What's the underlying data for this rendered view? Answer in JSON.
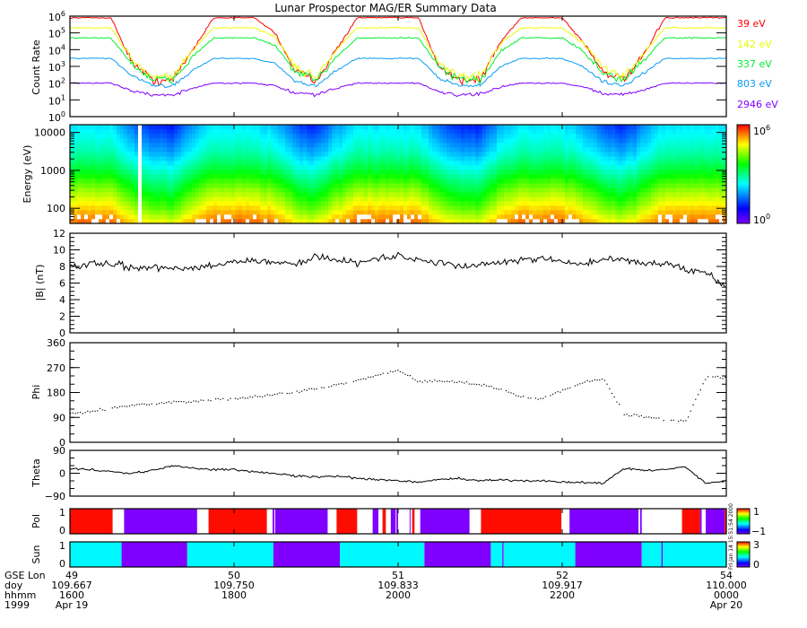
{
  "title": "Lunar Prospector MAG/ER Summary Data",
  "footer_timestamp": "Fri Jan 14 15:51:54 2000",
  "time_axis": {
    "row_labels": [
      "GSE Lon",
      "doy",
      "hhmm",
      "1999"
    ],
    "range_hours": [
      16,
      24
    ],
    "ticks": [
      {
        "hour": 16,
        "lon": "49",
        "doy": "109.667",
        "hhmm": "1600",
        "date": "Apr 19"
      },
      {
        "hour": 18,
        "lon": "50",
        "doy": "109.750",
        "hhmm": "1800",
        "date": ""
      },
      {
        "hour": 20,
        "lon": "51",
        "doy": "109.833",
        "hhmm": "2000",
        "date": ""
      },
      {
        "hour": 22,
        "lon": "52",
        "doy": "109.917",
        "hhmm": "2200",
        "date": ""
      },
      {
        "hour": 24,
        "lon": "54",
        "doy": "110.000",
        "hhmm": "0000",
        "date": "Apr 20"
      }
    ]
  },
  "chart_data": [
    {
      "type": "line",
      "ylabel": "Count Rate",
      "yscale": "log",
      "ylim": [
        1,
        1000000
      ],
      "yticks": [
        {
          "base": "10",
          "exp": "0"
        },
        {
          "base": "10",
          "exp": "1"
        },
        {
          "base": "10",
          "exp": "2"
        },
        {
          "base": "10",
          "exp": "3"
        },
        {
          "base": "10",
          "exp": "4"
        },
        {
          "base": "10",
          "exp": "5"
        },
        {
          "base": "10",
          "exp": "6"
        }
      ],
      "legend": "right",
      "x_hours": [
        16,
        16.25,
        16.5,
        16.75,
        17,
        17.25,
        17.5,
        17.75,
        18,
        18.25,
        18.5,
        18.75,
        19,
        19.25,
        19.5,
        19.75,
        20,
        20.25,
        20.5,
        20.75,
        21,
        21.25,
        21.5,
        21.75,
        22,
        22.25,
        22.5,
        22.75,
        23,
        23.25,
        23.5,
        23.75,
        24
      ],
      "series": [
        {
          "name": "39 eV",
          "color": "#ff0000",
          "values": [
            800000.0,
            800000.0,
            800000.0,
            2000.0,
            150,
            150,
            10000.0,
            800000.0,
            800000.0,
            800000.0,
            100000.0,
            500,
            150,
            10000.0,
            800000.0,
            800000.0,
            800000.0,
            800000.0,
            1000.0,
            150,
            150,
            30000.0,
            800000.0,
            800000.0,
            800000.0,
            30000.0,
            500,
            150,
            5000.0,
            800000.0,
            800000.0,
            800000.0,
            800000.0
          ]
        },
        {
          "name": "142 eV",
          "color": "#e8ff00",
          "values": [
            200000.0,
            200000.0,
            200000.0,
            3000.0,
            250,
            250,
            10000.0,
            200000.0,
            200000.0,
            200000.0,
            60000.0,
            800,
            250,
            10000.0,
            200000.0,
            200000.0,
            200000.0,
            200000.0,
            1500,
            250,
            250,
            25000.0,
            200000.0,
            200000.0,
            200000.0,
            25000.0,
            800,
            250,
            6000.0,
            200000.0,
            200000.0,
            200000.0,
            200000.0
          ]
        },
        {
          "name": "337 eV",
          "color": "#00f030",
          "values": [
            50000.0,
            50000.0,
            50000.0,
            1500,
            150,
            150,
            4000.0,
            50000.0,
            50000.0,
            50000.0,
            18000.0,
            400,
            150,
            4000.0,
            50000.0,
            50000.0,
            50000.0,
            50000.0,
            800,
            150,
            150,
            8000.0,
            50000.0,
            50000.0,
            50000.0,
            8000.0,
            400,
            150,
            2500,
            50000.0,
            50000.0,
            50000.0,
            50000.0
          ]
        },
        {
          "name": "803 eV",
          "color": "#0a9cf5",
          "values": [
            3000.0,
            3000.0,
            3000.0,
            300,
            70,
            70,
            600,
            3000.0,
            3000.0,
            3000.0,
            1500,
            120,
            70,
            600,
            3000.0,
            3000.0,
            3000.0,
            3000.0,
            200,
            70,
            70,
            1000.0,
            3000.0,
            3000.0,
            3000.0,
            1000.0,
            120,
            70,
            400,
            3000.0,
            3000.0,
            3000.0,
            3000.0
          ]
        },
        {
          "name": "2946 eV",
          "color": "#8000ff",
          "values": [
            100,
            100,
            100,
            35,
            20,
            20,
            50,
            100,
            100,
            100,
            70,
            25,
            20,
            50,
            100,
            100,
            100,
            100,
            30,
            20,
            20,
            60,
            100,
            100,
            100,
            60,
            25,
            20,
            40,
            100,
            100,
            100,
            100
          ]
        }
      ]
    },
    {
      "type": "heatmap",
      "ylabel": "Energy (eV)",
      "yscale": "log",
      "ylim": [
        40,
        16000
      ],
      "yticks": [
        "100",
        "1000",
        "10000"
      ],
      "colorbar": {
        "min": 1,
        "max": 1000000,
        "min_label": {
          "base": "10",
          "exp": "0"
        },
        "max_label": {
          "base": "10",
          "exp": "6"
        }
      },
      "energies": [
        50,
        100,
        300,
        1000,
        3000,
        10000
      ],
      "rows": [
        [
          250000.0,
          250000.0,
          250000.0,
          80000.0,
          40000.0,
          40000.0,
          130000.0,
          250000.0,
          250000.0,
          250000.0,
          180000.0,
          50000.0,
          40000.0,
          130000.0,
          250000.0,
          250000.0,
          250000.0,
          250000.0,
          65000.0,
          40000.0,
          40000.0,
          150000.0,
          250000.0,
          250000.0,
          250000.0,
          150000.0,
          50000.0,
          40000.0,
          100000.0,
          250000.0,
          250000.0,
          250000.0,
          250000.0
        ],
        [
          100000.0,
          100000.0,
          100000.0,
          25000.0,
          10000.0,
          10000.0,
          40000.0,
          100000.0,
          100000.0,
          100000.0,
          63000.0,
          16000.0,
          10000.0,
          40000.0,
          100000.0,
          100000.0,
          100000.0,
          100000.0,
          20000.0,
          10000.0,
          10000.0,
          50000.0,
          100000.0,
          100000.0,
          100000.0,
          50000.0,
          16000.0,
          10000.0,
          32000.0,
          100000.0,
          100000.0,
          100000.0,
          100000.0
        ],
        [
          20000.0,
          20000.0,
          20000.0,
          5000.0,
          2000.0,
          2000.0,
          8000.0,
          20000.0,
          20000.0,
          20000.0,
          12600.0,
          3200.0,
          2000.0,
          8000.0,
          20000.0,
          20000.0,
          20000.0,
          20000.0,
          4000.0,
          2000.0,
          2000.0,
          10000.0,
          20000.0,
          20000.0,
          20000.0,
          10000.0,
          3200.0,
          2000.0,
          6300.0,
          20000.0,
          20000.0,
          20000.0,
          20000.0
        ],
        [
          2500,
          2500,
          2500,
          800,
          400,
          400,
          1300,
          2500,
          2500,
          2500,
          1800,
          500,
          400,
          1300,
          2500,
          2500,
          2500,
          2500,
          650,
          400,
          400,
          1500,
          2500,
          2500,
          2500,
          1500,
          500,
          400,
          1000,
          2500,
          2500,
          2500,
          2500
        ],
        [
          630,
          630,
          630,
          180,
          80,
          80,
          280,
          630,
          630,
          630,
          420,
          120,
          80,
          280,
          630,
          630,
          630,
          630,
          150,
          80,
          80,
          340,
          630,
          630,
          630,
          340,
          120,
          80,
          220,
          630,
          630,
          630,
          630
        ],
        [
          250,
          250,
          250,
          60,
          20,
          20,
          100,
          250,
          250,
          250,
          150,
          35,
          20,
          100,
          250,
          250,
          250,
          250,
          45,
          20,
          20,
          120,
          250,
          250,
          250,
          120,
          35,
          20,
          80,
          250,
          250,
          250,
          250
        ]
      ],
      "no_data_hours": [
        [
          16.81,
          16.86
        ]
      ]
    },
    {
      "type": "line",
      "ylabel": "|B| (nT)",
      "ylim": [
        0,
        12
      ],
      "yticks": [
        "0",
        "2",
        "4",
        "6",
        "8",
        "10",
        "12"
      ],
      "values": [
        8,
        8.2,
        8.4,
        7.8,
        8,
        7.6,
        7.8,
        8.2,
        8.5,
        8.8,
        8.5,
        8.2,
        9.2,
        8.8,
        8.4,
        9,
        9.2,
        8.8,
        8.4,
        8,
        8.2,
        8.6,
        8.8,
        9,
        8.5,
        8.2,
        9,
        8.8,
        8.4,
        8.5,
        7.6,
        7.2,
        5.5
      ]
    },
    {
      "type": "scatter",
      "ylabel": "Phi",
      "ylim": [
        0,
        360
      ],
      "yticks": [
        "0",
        "90",
        "180",
        "270",
        "360"
      ],
      "values": [
        105,
        115,
        125,
        135,
        140,
        145,
        150,
        155,
        160,
        165,
        175,
        185,
        195,
        210,
        225,
        245,
        262,
        220,
        225,
        220,
        210,
        195,
        165,
        160,
        190,
        220,
        232,
        105,
        95,
        82,
        78,
        240,
        235
      ]
    },
    {
      "type": "line",
      "ylabel": "Theta",
      "ylim": [
        -90,
        90
      ],
      "yticks": [
        "90",
        "0",
        "−90"
      ],
      "values": [
        20,
        15,
        5,
        0,
        10,
        30,
        20,
        15,
        15,
        5,
        0,
        -10,
        -15,
        -10,
        -20,
        -25,
        -30,
        -35,
        -25,
        -20,
        -30,
        -25,
        -30,
        -30,
        -35,
        -35,
        -40,
        20,
        10,
        15,
        25,
        -40,
        -30
      ]
    },
    {
      "type": "bar-segments",
      "ylabel": "Pol",
      "yticks": [
        "0",
        "1"
      ],
      "colorbar": {
        "min_label": "−1",
        "max_label": "1"
      },
      "colors": {
        "1": "#ff0c00",
        "-1": "#7f00ff"
      },
      "segments": [
        [
          16.0,
          16.52,
          1
        ],
        [
          16.66,
          17.55,
          -1
        ],
        [
          17.69,
          18.4,
          1
        ],
        [
          18.47,
          18.49,
          -1
        ],
        [
          18.5,
          19.14,
          -1
        ],
        [
          19.25,
          19.5,
          1
        ],
        [
          19.69,
          19.76,
          -1
        ],
        [
          19.81,
          19.85,
          1
        ],
        [
          19.91,
          19.97,
          -1
        ],
        [
          19.98,
          20.0,
          -1
        ],
        [
          20.14,
          20.15,
          -1
        ],
        [
          20.17,
          20.2,
          1
        ],
        [
          20.27,
          20.87,
          -1
        ],
        [
          21.01,
          21.99,
          1
        ],
        [
          22.09,
          22.93,
          -1
        ],
        [
          22.95,
          22.97,
          -1
        ],
        [
          23.46,
          23.68,
          1
        ],
        [
          23.68,
          23.7,
          -1
        ],
        [
          23.75,
          23.98,
          -1
        ],
        [
          23.98,
          24.0,
          1
        ]
      ]
    },
    {
      "type": "bar-segments",
      "ylabel": "Sun",
      "yticks": [
        "0",
        "1"
      ],
      "colorbar": {
        "min_label": "0",
        "max_label": "3"
      },
      "colors": {
        "1": "#00f8ff",
        "0": "#7f00ff"
      },
      "segments": [
        [
          16.0,
          16.63,
          1
        ],
        [
          16.63,
          17.43,
          0
        ],
        [
          17.43,
          18.48,
          1
        ],
        [
          18.48,
          19.29,
          0
        ],
        [
          19.29,
          20.32,
          1
        ],
        [
          20.32,
          21.13,
          0
        ],
        [
          21.13,
          21.27,
          1
        ],
        [
          21.27,
          21.285,
          0
        ],
        [
          21.285,
          22.16,
          1
        ],
        [
          22.16,
          22.97,
          0
        ],
        [
          22.97,
          23.21,
          1
        ],
        [
          23.21,
          23.225,
          0
        ],
        [
          23.225,
          24.0,
          1
        ]
      ]
    }
  ]
}
